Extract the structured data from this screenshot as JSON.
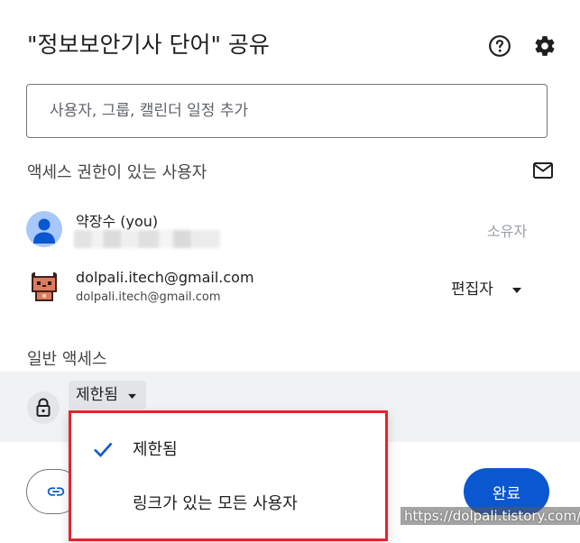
{
  "dialog": {
    "title": "\"정보보안기사 단어\" 공유",
    "help_icon": "help-circle-icon",
    "settings_icon": "gear-icon"
  },
  "search": {
    "placeholder": "사용자, 그룹, 캘린더 일정 추가",
    "value": ""
  },
  "people_section": {
    "title": "액세스 권한이 있는 사용자",
    "email_icon": "mail-icon",
    "people": [
      {
        "name": "약장수 (you)",
        "email": "",
        "role": "소유자",
        "avatar": "default-person-avatar"
      },
      {
        "name": "dolpali.itech@gmail.com",
        "email": "dolpali.itech@gmail.com",
        "role": "편집자",
        "avatar": "pixel-cat-avatar"
      }
    ]
  },
  "general_access": {
    "title": "일반 액세스",
    "icon": "lock-icon",
    "selected": "제한됨",
    "options": [
      {
        "label": "제한됨",
        "checked": true
      },
      {
        "label": "링크가 있는 모든 사용자",
        "checked": false
      }
    ]
  },
  "footer": {
    "copy_link_icon": "link-icon",
    "done_label": "완료"
  },
  "watermark": "https://dolpali.tistory.com/",
  "colors": {
    "primary": "#0b57d0",
    "highlight_border": "#e0262e",
    "avatar_blue": "#a8c7fa"
  }
}
